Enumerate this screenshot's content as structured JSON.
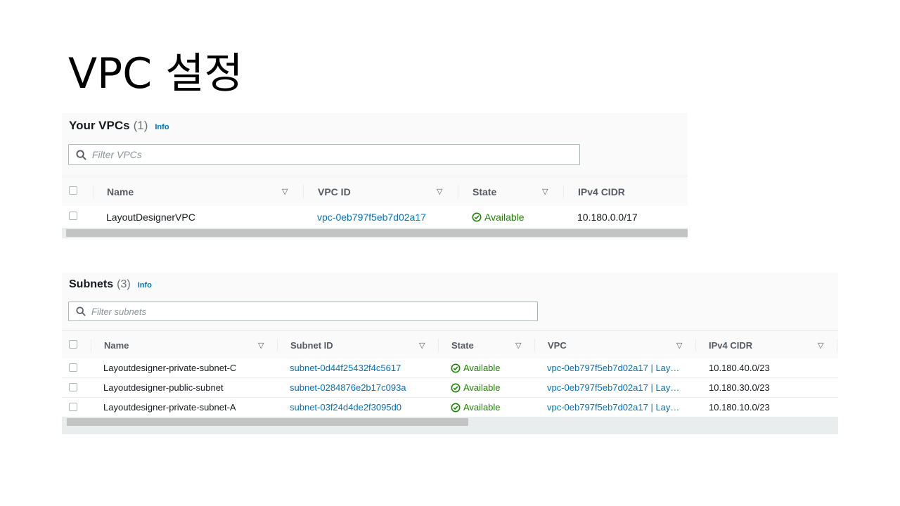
{
  "slide": {
    "title": "VPC 설정"
  },
  "vpcs": {
    "title": "Your VPCs",
    "count": "(1)",
    "info": "Info",
    "filter_placeholder": "Filter VPCs",
    "columns": {
      "name": "Name",
      "vpc_id": "VPC ID",
      "state": "State",
      "cidr": "IPv4 CIDR"
    },
    "rows": [
      {
        "name": "LayoutDesignerVPC",
        "vpc_id": "vpc-0eb797f5eb7d02a17",
        "state": "Available",
        "cidr": "10.180.0.0/17"
      }
    ]
  },
  "subnets": {
    "title": "Subnets",
    "count": "(3)",
    "info": "Info",
    "filter_placeholder": "Filter subnets",
    "columns": {
      "name": "Name",
      "subnet_id": "Subnet ID",
      "state": "State",
      "vpc": "VPC",
      "cidr": "IPv4 CIDR"
    },
    "rows": [
      {
        "name": "Layoutdesigner-private-subnet-C",
        "subnet_id": "subnet-0d44f25432f4c5617",
        "state": "Available",
        "vpc": "vpc-0eb797f5eb7d02a17 | Lay…",
        "cidr": "10.180.40.0/23"
      },
      {
        "name": "Layoutdesigner-public-subnet",
        "subnet_id": "subnet-0284876e2b17c093a",
        "state": "Available",
        "vpc": "vpc-0eb797f5eb7d02a17 | Lay…",
        "cidr": "10.180.30.0/23"
      },
      {
        "name": "Layoutdesigner-private-subnet-A",
        "subnet_id": "subnet-03f24d4de2f3095d0",
        "state": "Available",
        "vpc": "vpc-0eb797f5eb7d02a17 | Lay…",
        "cidr": "10.180.10.0/23"
      }
    ]
  },
  "colors": {
    "link": "#0073bb",
    "available": "#1d8102",
    "header_text": "#545b64",
    "border": "#eaeded"
  },
  "icons": {
    "search": "search-icon",
    "sort": "sort-down-triangle-icon",
    "status": "check-circle-icon"
  }
}
